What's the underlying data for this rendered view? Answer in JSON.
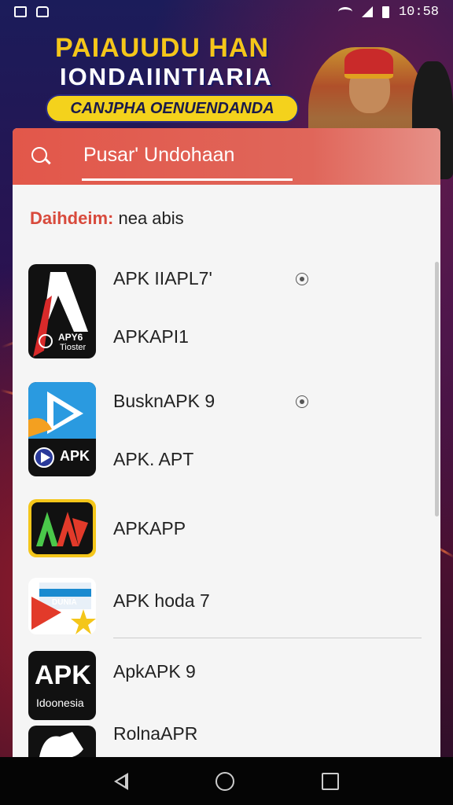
{
  "status_bar": {
    "time": "10:58",
    "icons": [
      "gallery-icon",
      "notification-icon",
      "wifi-icon",
      "signal-icon",
      "battery-icon"
    ]
  },
  "banner": {
    "line1": "PAIAUUDU HAN",
    "line2": "IONDAIINTIARIA",
    "pill": "CANJPHA OENUENDANDA"
  },
  "search": {
    "placeholder": "Pusar' Undohaan",
    "icon": "search-icon"
  },
  "section": {
    "heading_accent": "Daihdeim:",
    "heading_rest": " nea abis"
  },
  "apps": [
    {
      "badge_top": "APY6",
      "badge_bottom": "Tioster",
      "labels": [
        "APK IIAPL7'",
        "APKAPI1"
      ],
      "has_eye": true
    },
    {
      "badge": "APK",
      "labels": [
        "BusknAPK 9",
        "APK. APT"
      ],
      "has_eye": true
    },
    {
      "labels": [
        "APKAPP"
      ],
      "has_eye": false
    },
    {
      "badge": "DUNIA",
      "labels": [
        "APK hoda 7"
      ],
      "has_eye": false
    },
    {
      "badge_top": "APK",
      "badge_bottom": "Idoonesia",
      "labels": [
        "ApkAPK 9"
      ],
      "has_eye": false
    },
    {
      "labels": [
        "RolnaAPR"
      ],
      "has_eye": false
    }
  ],
  "colors": {
    "accent": "#e2574a",
    "banner_yellow": "#f4d21c",
    "card_bg": "#f5f5f5"
  }
}
